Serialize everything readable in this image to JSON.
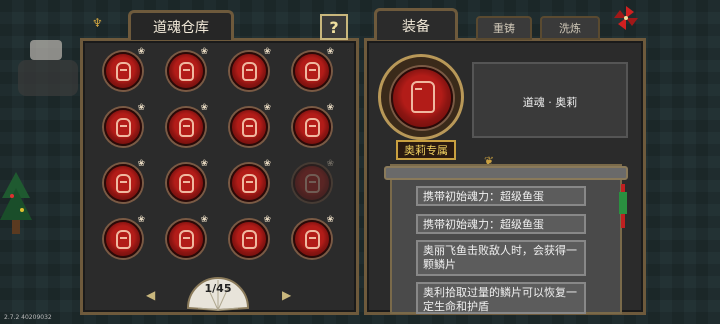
{
  "warehouse": {
    "title": "道魂仓库",
    "help_label": "?"
  },
  "tabs": {
    "equip": "装备",
    "forge": "重铸",
    "wash": "洗炼"
  },
  "grid": {
    "rows": 4,
    "cols": 4,
    "slots": [
      {
        "star": "❀",
        "dim": false
      },
      {
        "star": "❀",
        "dim": false
      },
      {
        "star": "❀",
        "dim": false
      },
      {
        "star": "❀",
        "dim": false
      },
      {
        "star": "❀",
        "dim": false
      },
      {
        "star": "❀",
        "dim": false
      },
      {
        "star": "❀",
        "dim": false
      },
      {
        "star": "❀",
        "dim": false
      },
      {
        "star": "❀",
        "dim": false
      },
      {
        "star": "❀",
        "dim": false
      },
      {
        "star": "❀",
        "dim": false
      },
      {
        "star": "❀",
        "dim": true
      },
      {
        "star": "❀",
        "dim": false
      },
      {
        "star": "❀",
        "dim": false
      },
      {
        "star": "❀",
        "dim": false
      },
      {
        "star": "❀",
        "dim": false
      }
    ]
  },
  "pager": {
    "indicator": "1/45",
    "prev": "◀",
    "next": "▶"
  },
  "equipped": {
    "name": "道魂 · 奥莉",
    "exclusive_badge": "奥莉专属"
  },
  "effects": [
    "携带初始魂力：超级鱼蛋",
    "携带初始魂力：超级鱼蛋",
    "奥丽飞鱼击败敌人时，会获得一颗鳞片",
    "奥利拾取过量的鳞片可以恢复一定生命和护盾"
  ],
  "version": "2.7.2 40209032",
  "colors": {
    "accent": "#c9a040",
    "orb_red": "#b21c18",
    "panel": "#2b2b2b",
    "frame": "#6e5a3c"
  }
}
